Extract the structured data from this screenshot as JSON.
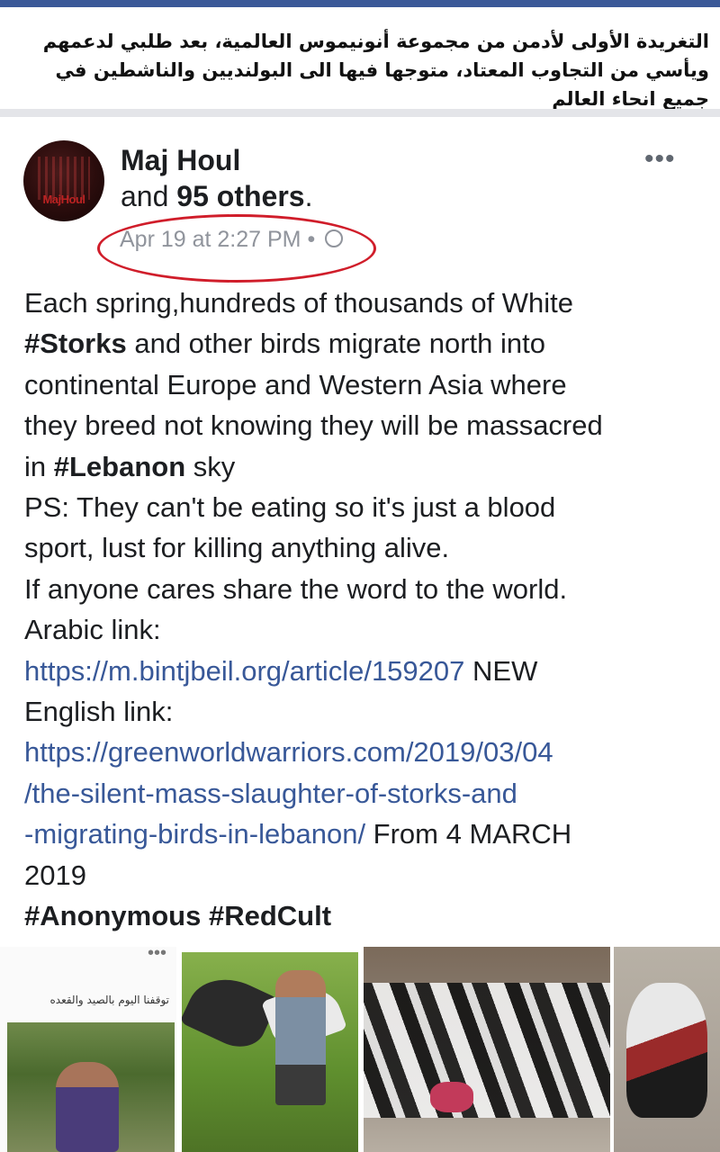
{
  "caption": {
    "text": "التغريدة الأولى لأدمن من مجموعة أنونيموس العالمية، بعد طلبي لدعمهم ويأسي من التجاوب المعتاد، متوجها فيها الى البولنديين والناشطين في جميع انحاء العالم"
  },
  "post": {
    "author": "Maj Houl",
    "others_prefix": "and ",
    "others_count": "95 others",
    "others_suffix": ".",
    "timestamp": "Apr 19 at 2:27 PM",
    "meta_separator": "•",
    "privacy_icon": "globe-icon",
    "more_label": "•••",
    "avatar_logo": "MajHoul",
    "body": {
      "l1": "Each spring,hundreds of thousands of White",
      "tag_storks": "#Storks",
      "l2_rest": " and other birds migrate north into",
      "l3": "continental Europe and Western Asia where",
      "l4": "they breed not knowing they will be massacred",
      "l5_pre": "in ",
      "tag_lebanon": "#Lebanon",
      "l5_post": " sky",
      "ps1": "PS: They can't be eating so it's just a blood",
      "ps2": "sport, lust for killing anything alive.",
      "share": "If anyone cares share the word to the world.",
      "arabic_label": "Arabic link:",
      "arabic_url": "https://m.bintjbeil.org/article/159207",
      "arabic_suffix": " NEW",
      "english_label": "English link:",
      "english_url_1": "https://greenworldwarriors.com/2019/03/04",
      "english_url_2": "/the-silent-mass-slaughter-of-storks-and",
      "english_url_3": "-migrating-birds-in-lebanon/",
      "english_suffix": " From 4 MARCH",
      "year": "2019",
      "tag_anonymous": "#Anonymous",
      "tag_redcult": "#RedCult"
    }
  },
  "photos": {
    "p1_dots": "•••",
    "p1_caption": "توقفنا اليوم بالصيد والقعده"
  },
  "colors": {
    "facebook_blue": "#3b5998",
    "link": "#385898",
    "meta_gray": "#90949c",
    "annotation_red": "#d01d2a"
  }
}
